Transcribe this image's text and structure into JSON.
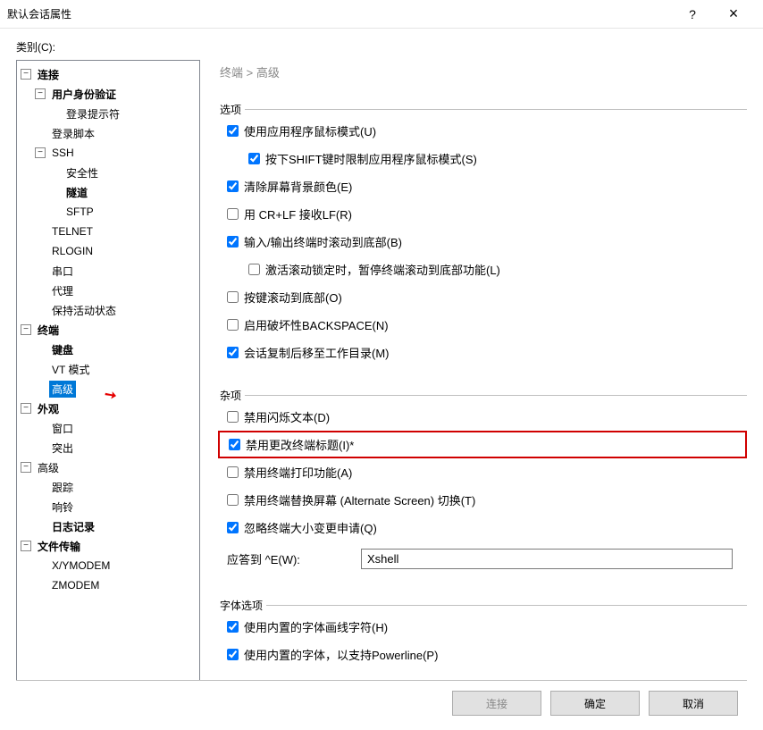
{
  "titlebar": {
    "title": "默认会话属性",
    "help": "?",
    "close": "×"
  },
  "categories_label": "类别(C):",
  "tree": {
    "connection": "连接",
    "auth": "用户身份验证",
    "prompt": "登录提示符",
    "login_script": "登录脚本",
    "ssh": "SSH",
    "security": "安全性",
    "tunnel": "隧道",
    "sftp": "SFTP",
    "telnet": "TELNET",
    "rlogin": "RLOGIN",
    "serial": "串口",
    "proxy": "代理",
    "keepalive": "保持活动状态",
    "terminal": "终端",
    "keyboard": "键盘",
    "vt": "VT 模式",
    "advanced_term": "高级",
    "appearance": "外观",
    "window": "窗口",
    "highlight": "突出",
    "advanced": "高级",
    "trace": "跟踪",
    "bell": "响铃",
    "logging": "日志记录",
    "file_transfer": "文件传输",
    "xymodem": "X/YMODEM",
    "zmodem": "ZMODEM"
  },
  "breadcrumb": {
    "p1": "终端",
    "sep": "  >  ",
    "p2": "高级"
  },
  "groups": {
    "options": "选项",
    "misc": "杂项",
    "font": "字体选项"
  },
  "opts": {
    "mouse_mode": "使用应用程序鼠标模式(U)",
    "shift_mouse": "按下SHIFT键时限制应用程序鼠标模式(S)",
    "clear_bg": "清除屏幕背景颜色(E)",
    "crlf": "用 CR+LF 接收LF(R)",
    "scroll_io": "输入/输出终端时滚动到底部(B)",
    "scroll_lock": "激活滚动锁定时，暂停终端滚动到底部功能(L)",
    "scroll_key": "按键滚动到底部(O)",
    "backspace": "启用破坏性BACKSPACE(N)",
    "copy_dir": "会话复制后移至工作目录(M)",
    "disable_blink": "禁用闪烁文本(D)",
    "disable_title": "禁用更改终端标题(I)*",
    "disable_print": "禁用终端打印功能(A)",
    "disable_altscreen": "禁用终端替换屏幕 (Alternate Screen) 切换(T)",
    "ignore_resize": "忽略终端大小变更申请(Q)",
    "response_label": "应答到 ^E(W):",
    "response_value": "Xshell",
    "font_line": "使用内置的字体画线字符(H)",
    "font_powerline": "使用内置的字体，以支持Powerline(P)"
  },
  "checked": {
    "mouse_mode": true,
    "shift_mouse": true,
    "clear_bg": true,
    "crlf": false,
    "scroll_io": true,
    "scroll_lock": false,
    "scroll_key": false,
    "backspace": false,
    "copy_dir": true,
    "disable_blink": false,
    "disable_title": true,
    "disable_print": false,
    "disable_altscreen": false,
    "ignore_resize": true,
    "font_line": true,
    "font_powerline": true
  },
  "buttons": {
    "connect": "连接",
    "ok": "确定",
    "cancel": "取消"
  }
}
